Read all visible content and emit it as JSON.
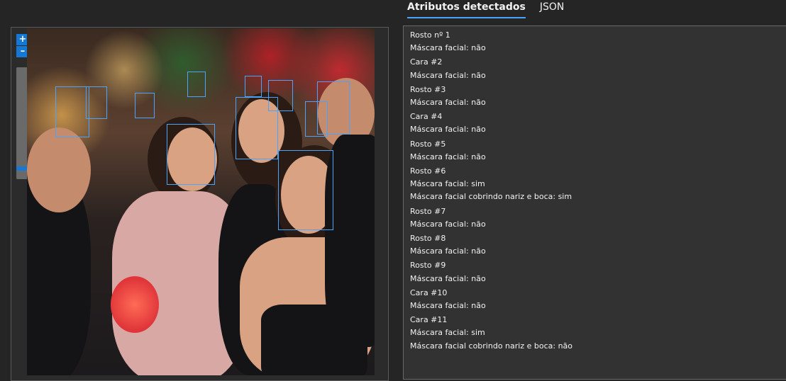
{
  "tabs": [
    {
      "label": "Atributos detectados",
      "active": true
    },
    {
      "label": "JSON",
      "active": false
    }
  ],
  "zoom": {
    "plus": "+",
    "minus": "–"
  },
  "results": [
    {
      "title": "Rosto nº 1",
      "lines": [
        "Máscara facial: não"
      ]
    },
    {
      "title": "Cara #2",
      "lines": [
        "Máscara facial: não"
      ]
    },
    {
      "title": "Rosto #3",
      "lines": [
        "Máscara facial: não"
      ]
    },
    {
      "title": "Cara #4",
      "lines": [
        "Máscara facial: não"
      ]
    },
    {
      "title": "Rosto #5",
      "lines": [
        "Máscara facial: não"
      ]
    },
    {
      "title": "Rosto #6",
      "lines": [
        "Máscara facial: sim",
        "Máscara facial cobrindo nariz e boca: sim"
      ]
    },
    {
      "title": "Rosto #7",
      "lines": [
        "Máscara facial: não"
      ]
    },
    {
      "title": "Rosto #8",
      "lines": [
        "Máscara facial: não"
      ]
    },
    {
      "title": "Rosto #9",
      "lines": [
        "Máscara facial: não"
      ]
    },
    {
      "title": "Cara #10",
      "lines": [
        "Máscara facial: não"
      ]
    },
    {
      "title": "Cara #11",
      "lines": [
        "Máscara facial: sim",
        "Máscara facial cobrindo nariz e boca: não"
      ]
    }
  ]
}
